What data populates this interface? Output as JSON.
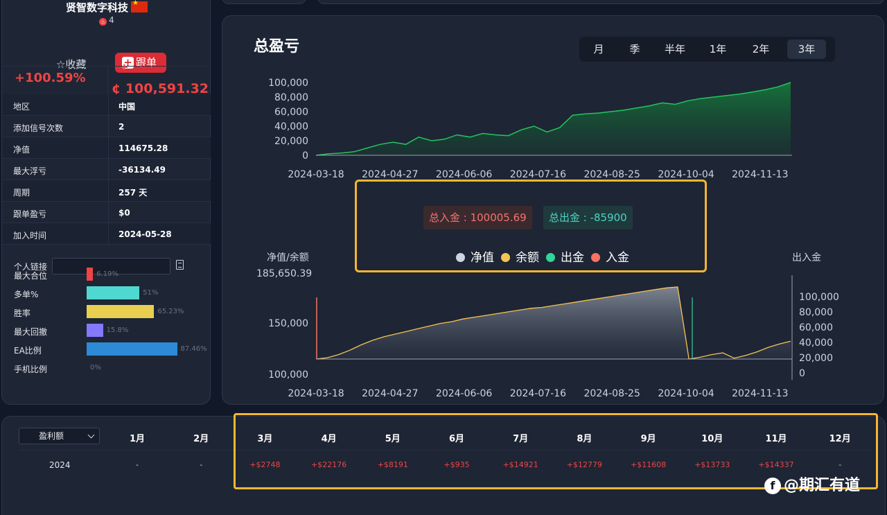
{
  "profile": {
    "name": "贤智数字科技",
    "hot_count": "4",
    "fav_label": "☆收藏",
    "follow_label": "跟单",
    "return_pct": "+100.59%",
    "profit_sign": "+",
    "profit_amount": "¢ 100,591.32"
  },
  "stats": [
    {
      "k": "地区",
      "v": "中国"
    },
    {
      "k": "添加信号次数",
      "v": "2"
    },
    {
      "k": "净值",
      "v": "114675.28"
    },
    {
      "k": "最大浮亏",
      "v": "-36134.49"
    },
    {
      "k": "周期",
      "v": "257 天"
    },
    {
      "k": "跟单盈亏",
      "v": "$0"
    },
    {
      "k": "加入时间",
      "v": "2024-05-28"
    }
  ],
  "link_label": "个人链接",
  "bars": [
    {
      "label": "最大合位",
      "pct": "6.19%",
      "value": 6.19,
      "color": "#ef4444"
    },
    {
      "label": "多单%",
      "pct": "51%",
      "value": 51,
      "color": "#4fd8d0"
    },
    {
      "label": "胜率",
      "pct": "65.23%",
      "value": 65.23,
      "color": "#e8cf4f"
    },
    {
      "label": "最大回撤",
      "pct": "15.8%",
      "value": 15.8,
      "color": "#8379ff"
    },
    {
      "label": "EA比例",
      "pct": "87.46%",
      "value": 87.46,
      "color": "#2d8ad6"
    },
    {
      "label": "手机比例",
      "pct": "0%",
      "value": 0,
      "color": "#6b7280"
    }
  ],
  "chart": {
    "title": "总盈亏",
    "ranges": [
      "月",
      "季",
      "半年",
      "1年",
      "2年",
      "3年"
    ],
    "active_range": "3年",
    "deposit_label": "总入金 : 100005.69",
    "withdraw_label": "总出金 : -85900",
    "legend": [
      {
        "name": "净值",
        "color": "#cbd5e1"
      },
      {
        "name": "余额",
        "color": "#f6c453"
      },
      {
        "name": "出金",
        "color": "#34d399"
      },
      {
        "name": "入金",
        "color": "#f97362"
      }
    ],
    "left_axis_title": "净值/余额",
    "right_axis_title": "出入金",
    "max_label": "185,650.39"
  },
  "chart_data": [
    {
      "type": "area",
      "title": "",
      "x": [
        "2024-03-18",
        "2024-04-27",
        "2024-06-06",
        "2024-07-16",
        "2024-08-25",
        "2024-10-04",
        "2024-11-13"
      ],
      "yticks": [
        "100,000",
        "80,000",
        "60,000",
        "40,000",
        "20,000",
        "0"
      ],
      "ylim": [
        0,
        100000
      ],
      "series": [
        {
          "values": [
            0,
            2000,
            3000,
            5000,
            10000,
            15000,
            18000,
            15000,
            25000,
            20000,
            22000,
            28000,
            25000,
            30000,
            28000,
            27000,
            35000,
            40000,
            32000,
            38000,
            55000,
            57000,
            58000,
            60000,
            62000,
            65000,
            68000,
            72000,
            70000,
            75000,
            78000,
            80000,
            82000,
            84000,
            87000,
            90000,
            94000,
            100000
          ]
        }
      ]
    },
    {
      "type": "area",
      "title": "",
      "x": [
        "2024-03-18",
        "2024-04-27",
        "2024-06-06",
        "2024-07-16",
        "2024-08-25",
        "2024-10-04",
        "2024-11-13"
      ],
      "yticks_left": [
        "150,000",
        "100,000"
      ],
      "yticks_right": [
        "100,000",
        "80,000",
        "60,000",
        "40,000",
        "20,000",
        "0"
      ],
      "ylim": [
        100000,
        185650.39
      ],
      "series": [
        {
          "name": "净值",
          "values": [
            100000,
            101500,
            105000,
            110000,
            116000,
            121000,
            125000,
            128000,
            131000,
            134000,
            137000,
            140000,
            142000,
            145000,
            147000,
            149000,
            151000,
            153000,
            155000,
            157000,
            158000,
            160000,
            162000,
            164000,
            166000,
            168000,
            170000,
            172000,
            174000,
            176000,
            178000,
            180000,
            181000,
            100000,
            102000,
            105000,
            107000,
            101000,
            104000,
            108000,
            113000,
            117000,
            120000
          ]
        },
        {
          "name": "余额",
          "values": [
            100000,
            101500,
            105000,
            110000,
            116000,
            121000,
            125000,
            128000,
            131000,
            134000,
            137000,
            140000,
            142000,
            145000,
            147000,
            149000,
            151000,
            153000,
            155000,
            157000,
            158000,
            160000,
            162000,
            164000,
            166000,
            168000,
            170000,
            172000,
            174000,
            176000,
            178000,
            180000,
            181000,
            100000,
            102000,
            105000,
            107000,
            101000,
            104000,
            108000,
            113000,
            117000,
            120000
          ]
        }
      ]
    }
  ],
  "monthly": {
    "select_label": "盈利额",
    "months": [
      "1月",
      "2月",
      "3月",
      "4月",
      "5月",
      "6月",
      "7月",
      "8月",
      "9月",
      "10月",
      "11月",
      "12月"
    ],
    "year": "2024",
    "values": [
      "-",
      "-",
      "+$2748",
      "+$22176",
      "+$8191",
      "+$935",
      "+$14921",
      "+$12779",
      "+$11608",
      "+$13733",
      "+$14337",
      "-"
    ]
  },
  "watermark": "@期汇有道"
}
